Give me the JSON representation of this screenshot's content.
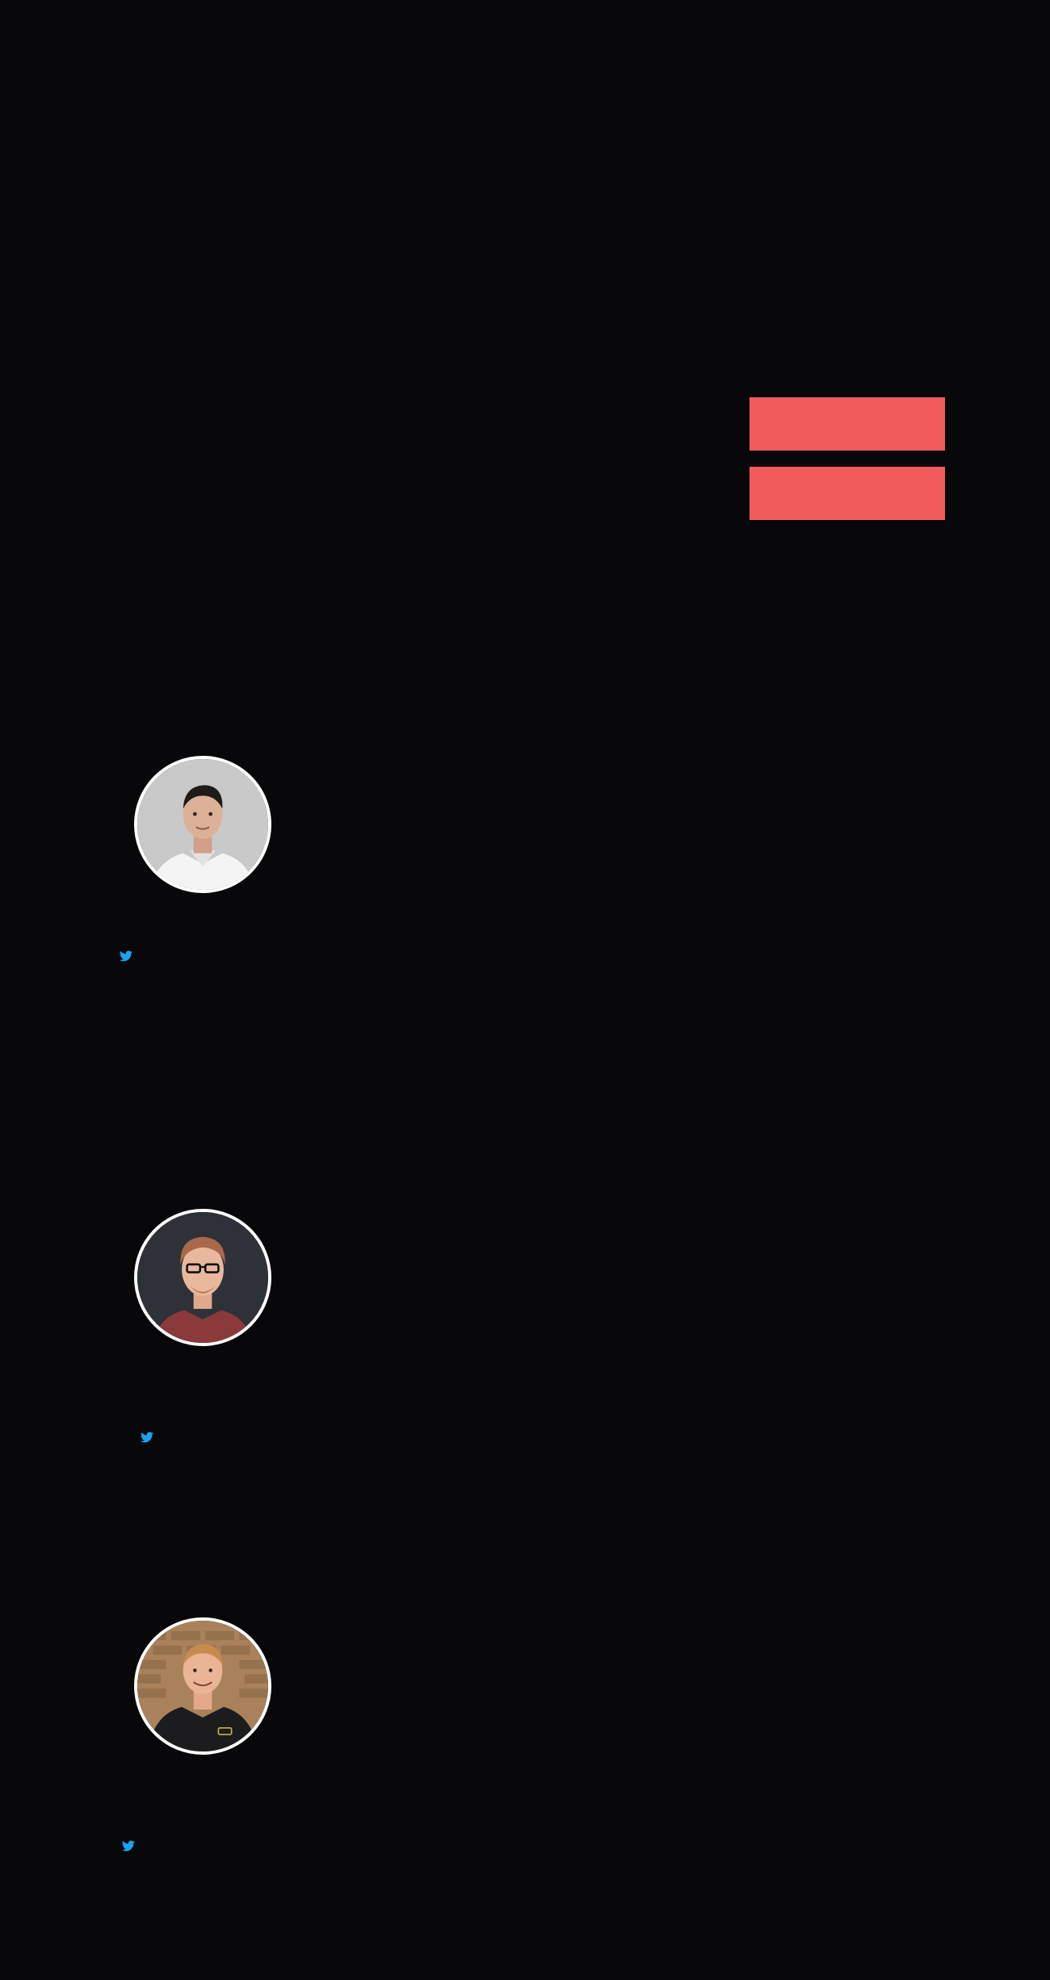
{
  "cta": {
    "primary_label": "",
    "secondary_label": "",
    "color": "#f25b5b"
  },
  "team": [
    {
      "avatar": "person-avatar-1",
      "social_icon": "twitter-icon"
    },
    {
      "avatar": "person-avatar-2",
      "social_icon": "twitter-icon"
    },
    {
      "avatar": "person-avatar-3",
      "social_icon": "twitter-icon"
    }
  ],
  "colors": {
    "background": "#08080a",
    "accent": "#f25b5b",
    "twitter": "#1da1f2",
    "avatar_border": "#ffffff"
  }
}
